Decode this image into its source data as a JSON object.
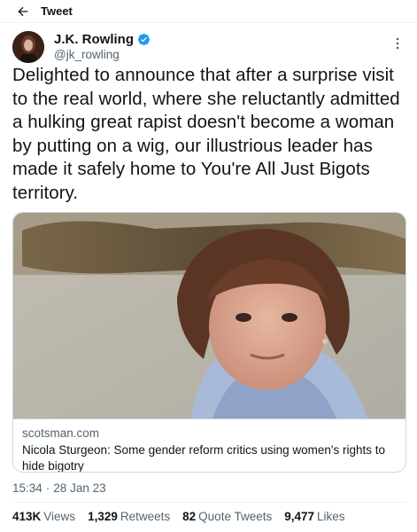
{
  "topbar": {
    "title": "Tweet",
    "back_icon": "arrow-left-icon"
  },
  "author": {
    "display_name": "J.K. Rowling",
    "handle": "@jk_rowling",
    "verified_icon": "verified-badge-icon",
    "verified_color": "#1d9bf0"
  },
  "tweet": {
    "text": "Delighted to announce that after a surprise visit to the real world, where she reluctantly admitted a hulking great rapist doesn't become a woman by putting on a wig, our illustrious leader has made it safely home to You're All Just Bigots territory."
  },
  "card": {
    "domain": "scotsman.com",
    "title": "Nicola Sturgeon: Some gender reform critics using women's rights to hide bigotry"
  },
  "meta": {
    "time": "15:34",
    "date": "28 Jan 23"
  },
  "stats": {
    "views_count": "413K",
    "views_label": "Views",
    "retweets_count": "1,329",
    "retweets_label": "Retweets",
    "quotes_count": "82",
    "quotes_label": "Quote Tweets",
    "likes_count": "9,477",
    "likes_label": "Likes"
  },
  "colors": {
    "text": "#0f1419",
    "secondary": "#536471",
    "border": "#cfd9de",
    "accent": "#1d9bf0"
  }
}
